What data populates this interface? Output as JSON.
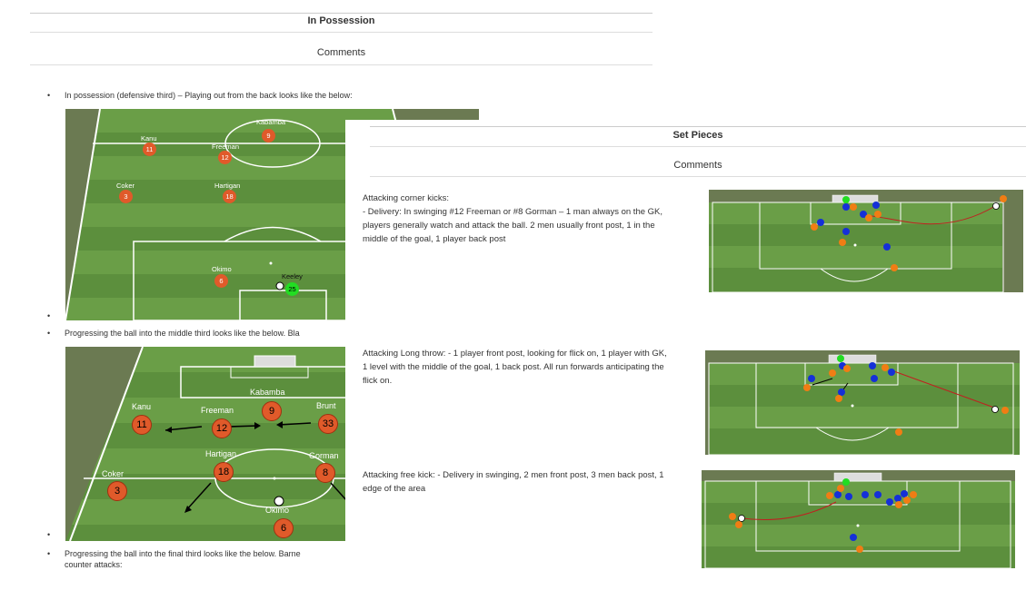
{
  "left_doc": {
    "section_title": "In Possession",
    "comments_title": "Comments",
    "bullets": [
      "In possession (defensive third) – Playing out from the back looks like the below:",
      "Progressing the ball into the middle third looks like the below. Bla",
      "Progressing the ball into the final third looks like the below. Barne",
      "counter attacks:"
    ],
    "diagram1_players": [
      {
        "name": "Kabamba",
        "num": "9"
      },
      {
        "name": "Kanu",
        "num": "11"
      },
      {
        "name": "Freeman",
        "num": "12"
      },
      {
        "name": "Brunt",
        "num": "33"
      },
      {
        "name": "Coker",
        "num": "3"
      },
      {
        "name": "Hartigan",
        "num": "18"
      },
      {
        "name": "Gorman",
        "num": "8"
      },
      {
        "name": "Okimo",
        "num": "6"
      },
      {
        "name": "Keeley",
        "num": "25"
      }
    ],
    "diagram2_players": [
      {
        "name": "Kanu",
        "num": "11"
      },
      {
        "name": "Freeman",
        "num": "12"
      },
      {
        "name": "Kabamba",
        "num": "9"
      },
      {
        "name": "Brunt",
        "num": "33"
      },
      {
        "name": "Hartigan",
        "num": "18"
      },
      {
        "name": "Gorman",
        "num": "8"
      },
      {
        "name": "Coker",
        "num": "3"
      },
      {
        "name": "Okimo",
        "num": "6"
      }
    ]
  },
  "right_doc": {
    "section_title": "Set Pieces",
    "comments_title": "Comments",
    "corner_text": "Attacking corner kicks:\n- Delivery: In swinging #12 Freeman or #8 Gorman – 1 man always on the GK, players generally watch and attack the ball. 2 men usually front post, 1 in the middle of the goal, 1 player back post",
    "throw_text": "Attacking Long throw: - 1 player front post, looking for flick on, 1 player with GK, 1 level with the middle of the goal, 1 back post. All run forwards anticipating the flick on.",
    "freekick_text": "Attacking free kick: - Delivery in swinging, 2 men front post, 3 men back post, 1 edge of the area"
  },
  "colors": {
    "pitch_light": "#6a9e47",
    "pitch_dark": "#5c8f3d",
    "outside": "#6b7a52",
    "player": "#e05a2a",
    "keeper": "#22dd22",
    "blue": "#1530d8",
    "orange": "#f07d14"
  }
}
